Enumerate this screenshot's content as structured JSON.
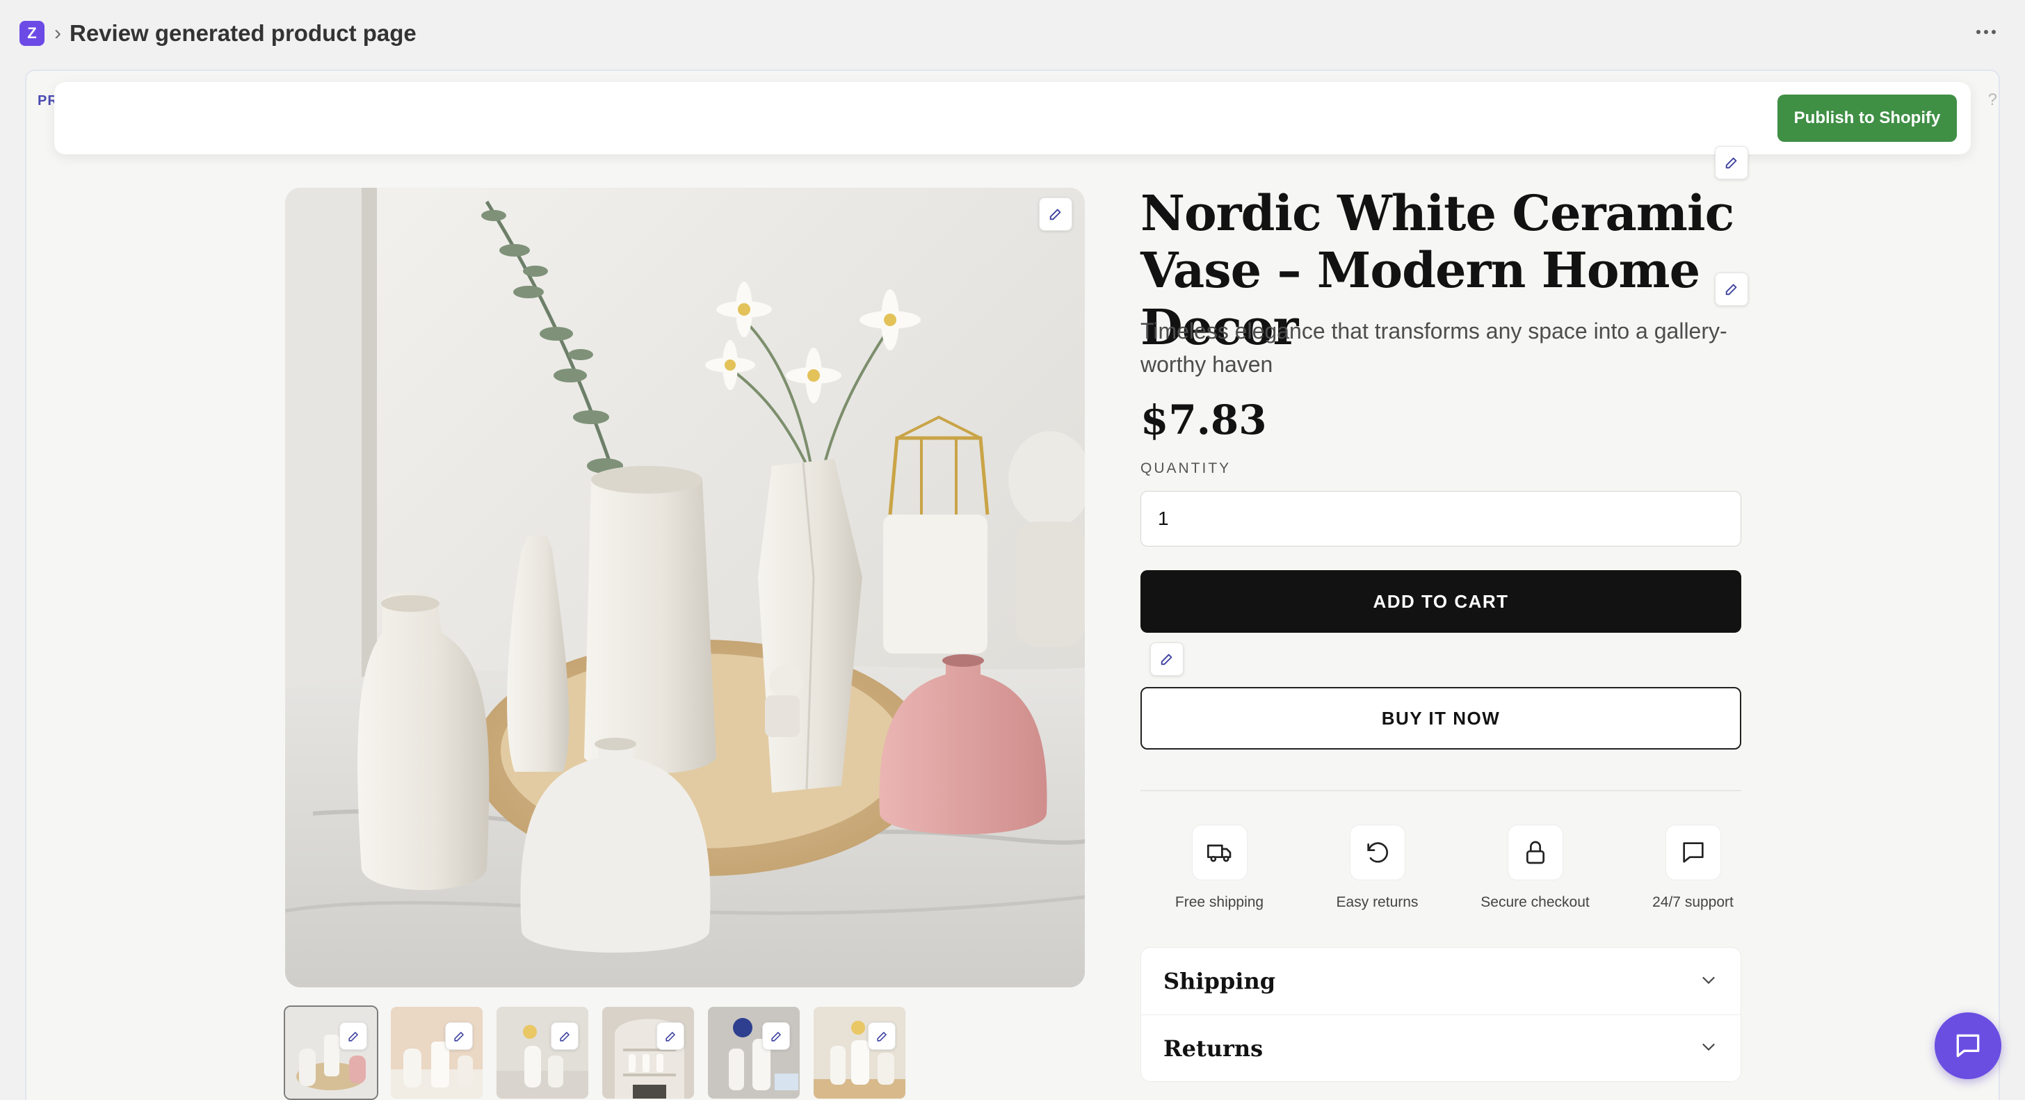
{
  "app": {
    "logo_letter": "Z",
    "breadcrumb_separator": "›",
    "page_title": "Review generated product page"
  },
  "preview": {
    "tag": "PR",
    "publish_label": "Publish to Shopify"
  },
  "product": {
    "title": "Nordic White Ceramic Vase – Modern Home Decor",
    "subtitle": "Timeless elegance that transforms any space into a gallery-worthy haven",
    "price": "$7.83",
    "quantity_label": "QUANTITY",
    "quantity_value": "1",
    "add_to_cart_label": "ADD TO CART",
    "buy_now_label": "BUY IT NOW",
    "thumbnail_count": 6,
    "active_thumbnail": 1
  },
  "badges": [
    {
      "icon": "truck-icon",
      "label": "Free shipping"
    },
    {
      "icon": "rotate-ccw-icon",
      "label": "Easy returns"
    },
    {
      "icon": "lock-icon",
      "label": "Secure checkout"
    },
    {
      "icon": "message-square-icon",
      "label": "24/7 support"
    }
  ],
  "accordion": [
    {
      "title": "Shipping"
    },
    {
      "title": "Returns"
    }
  ],
  "colors": {
    "brand": "#6b4ae6",
    "publish": "#3f8f45",
    "cart": "#121212",
    "chat": "#6a4ee2",
    "vase_pink": "#e0a6a5"
  }
}
